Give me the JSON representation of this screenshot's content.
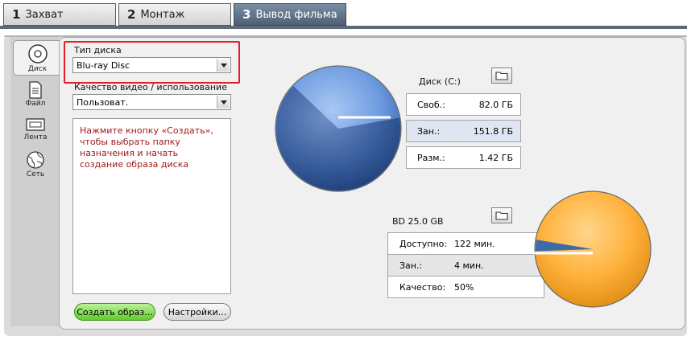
{
  "tabs": [
    {
      "num": "1",
      "label": "Захват"
    },
    {
      "num": "2",
      "label": "Монтаж"
    },
    {
      "num": "3",
      "label": "Вывод фильма"
    }
  ],
  "rail": [
    {
      "label": "Диск",
      "icon": "disc-icon"
    },
    {
      "label": "Файл",
      "icon": "file-icon"
    },
    {
      "label": "Лента",
      "icon": "tape-icon"
    },
    {
      "label": "Сеть",
      "icon": "globe-icon"
    }
  ],
  "form": {
    "disc_type_label": "Тип диска",
    "disc_type_value": "Blu-ray Disc",
    "quality_label": "Качество видео / использование",
    "quality_value": "Пользоват.",
    "info_text": "Нажмите кнопку «Создать», чтобы выбрать папку назначения и начать создание образа диска",
    "create_button": "Создать образ...",
    "settings_button": "Настройки..."
  },
  "drive": {
    "title": "Диск (C:)",
    "free_label": "Своб.:",
    "free_value": "82.0 ГБ",
    "used_label": "Зан.:",
    "used_value": "151.8 ГБ",
    "size_label": "Разм.:",
    "size_value": "1.42 ГБ",
    "used_fraction": 0.649
  },
  "target": {
    "title": "BD   25.0 GB",
    "available_label": "Доступно:",
    "available_value": "122 мин.",
    "used_label": "Зан.:",
    "used_value": "4 мин.",
    "quality_label": "Качество:",
    "quality_value": "50%",
    "used_fraction": 0.032
  },
  "colors": {
    "drive_pie": "#5b8fd6",
    "target_pie": "#ffad33",
    "highlight_box": "#e0202a",
    "info_text": "#a11a1a",
    "active_tab": "#5c6f85",
    "create_button": "#6ad035"
  }
}
